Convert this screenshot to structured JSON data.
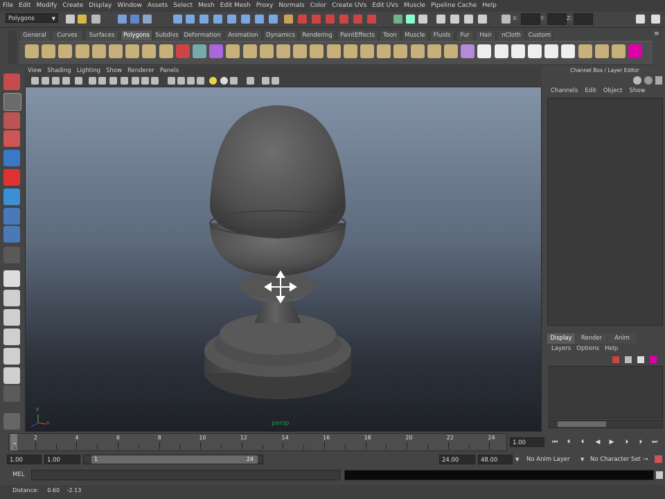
{
  "menu": [
    "File",
    "Edit",
    "Modify",
    "Create",
    "Display",
    "Window",
    "Assets",
    "Select",
    "Mesh",
    "Edit Mesh",
    "Proxy",
    "Normals",
    "Color",
    "Create UVs",
    "Edit UVs",
    "Muscle",
    "Pipeline Cache",
    "Help"
  ],
  "status": {
    "mode": "Polygons",
    "x_label": "X:",
    "y_label": "Y:",
    "z_label": "Z:"
  },
  "shelf_tabs": [
    "General",
    "Curves",
    "Surfaces",
    "Polygons",
    "Subdivs",
    "Deformation",
    "Animation",
    "Dynamics",
    "Rendering",
    "PaintEffects",
    "Toon",
    "Muscle",
    "Fluids",
    "Fur",
    "Hair",
    "nCloth",
    "Custom"
  ],
  "shelf_active": "Polygons",
  "panel_menu": [
    "View",
    "Shading",
    "Lighting",
    "Show",
    "Renderer",
    "Panels"
  ],
  "viewport": {
    "camera_label": "persp",
    "axis_y": "y",
    "axis_x": "x"
  },
  "channel_box": {
    "title": "Channel Box / Layer Editor",
    "menu": [
      "Channels",
      "Edit",
      "Object",
      "Show"
    ]
  },
  "layer_editor": {
    "tabs": [
      "Display",
      "Render",
      "Anim"
    ],
    "menu": [
      "Layers",
      "Options",
      "Help"
    ]
  },
  "time_slider": {
    "ticks": [
      "2",
      "4",
      "6",
      "8",
      "10",
      "12",
      "14",
      "16",
      "18",
      "20",
      "22",
      "24"
    ],
    "current_frame_marker": "1",
    "current_frame": "1.00"
  },
  "range": {
    "start_time": "1.00",
    "playback_start": "1.00",
    "slider_start": "1",
    "slider_end": "24",
    "playback_end": "24.00",
    "end_time": "48.00",
    "anim_layer": "No Anim Layer",
    "character_set": "No Character Set"
  },
  "command_line": {
    "label": "MEL"
  },
  "help_line": {
    "label": "Distance:",
    "value1": "0.60",
    "value2": "-2.13"
  },
  "colors": {
    "viewport_top": "#8393a8",
    "viewport_bottom": "#1e2127",
    "model": "#5a5a5a",
    "accent": "#1f9a4a"
  }
}
